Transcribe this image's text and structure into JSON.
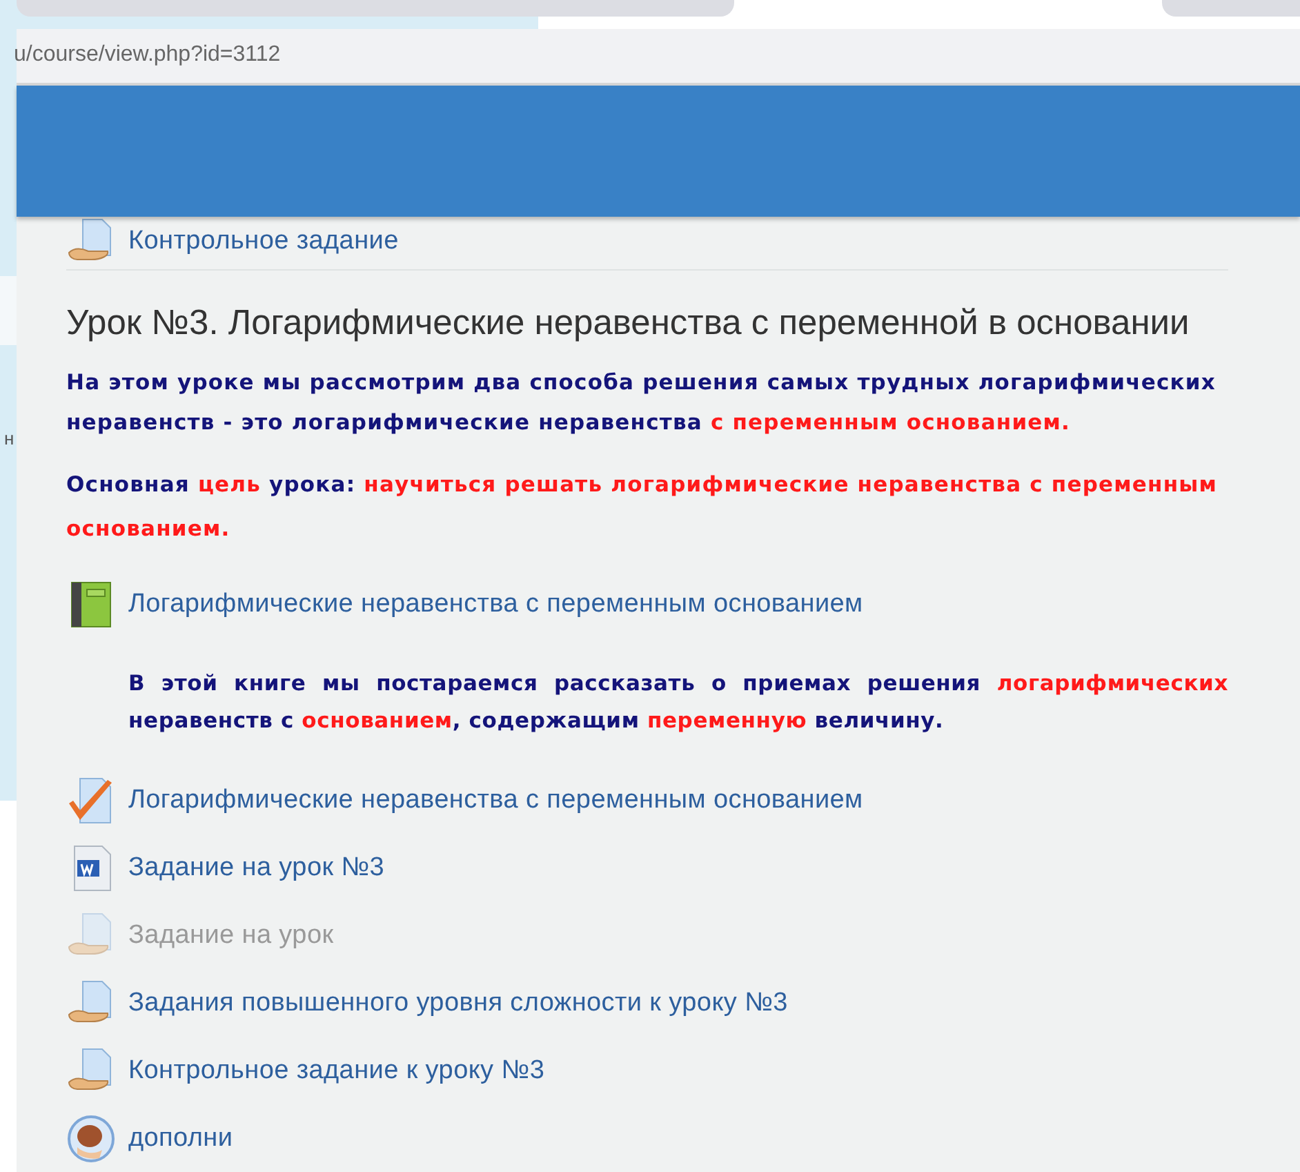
{
  "background_window": {
    "text": "н"
  },
  "address_bar": {
    "url": "u/course/view.php?id=3112"
  },
  "previous_item": {
    "kind": "page",
    "label": "Контрольное задание"
  },
  "section": {
    "title": "Урок №3. Логарифмические неравенства с переменной в основании",
    "paragraphs": [
      [
        {
          "text": "На этом уроке мы рассмотрим два способа решения самых трудных логарифмических неравенств - это логарифмические неравенства ",
          "highlight": false
        },
        {
          "text": "с переменным основанием.",
          "highlight": true
        }
      ],
      [
        {
          "text": "Основная ",
          "highlight": false
        },
        {
          "text": "цель",
          "highlight": true
        },
        {
          "text": " урока: ",
          "highlight": false
        },
        {
          "text": "научиться решать логарифмические неравенства с переменным основанием.",
          "highlight": true
        }
      ]
    ],
    "activities": [
      {
        "kind": "book",
        "label": "Логарифмические неравенства с переменным основанием",
        "disabled": false,
        "description": [
          {
            "text": "В этой книге мы постараемся рассказать о приемах решения ",
            "highlight": false
          },
          {
            "text": "логарифмических",
            "highlight": true
          },
          {
            "text": " неравенств с ",
            "highlight": false
          },
          {
            "text": "основанием",
            "highlight": true
          },
          {
            "text": ", содержащим ",
            "highlight": false
          },
          {
            "text": "переменную",
            "highlight": true
          },
          {
            "text": " величину.",
            "highlight": false
          }
        ]
      },
      {
        "kind": "quiz",
        "label": "Логарифмические неравенства с переменным основанием",
        "disabled": false
      },
      {
        "kind": "word",
        "label": "Задание на урок №3",
        "disabled": false
      },
      {
        "kind": "page",
        "label": "Задание на урок",
        "disabled": true
      },
      {
        "kind": "page",
        "label": "Задания повышенного уровня сложности к уроку №3",
        "disabled": false
      },
      {
        "kind": "page",
        "label": "Контрольное задание к уроку №3",
        "disabled": false
      },
      {
        "kind": "feedback",
        "label": "дополни",
        "disabled": false
      }
    ]
  }
}
